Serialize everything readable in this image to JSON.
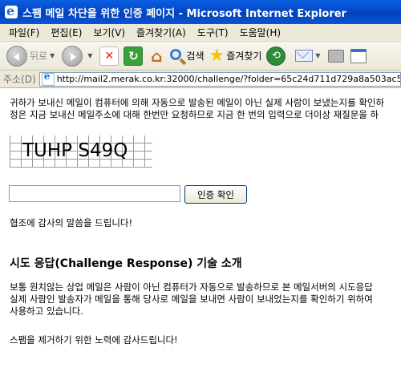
{
  "window": {
    "title": "스팸 메일 차단을 위한 인증 페이지 - Microsoft Internet Explorer"
  },
  "menu": {
    "items": [
      "파일(F)",
      "편집(E)",
      "보기(V)",
      "즐겨찾기(A)",
      "도구(T)",
      "도움말(H)"
    ]
  },
  "toolbar": {
    "back_label": "뒤로",
    "search_label": "검색",
    "favorites_label": "즐겨찾기"
  },
  "address": {
    "label": "주소(D)",
    "url": "http://mail2.merak.co.kr:32000/challenge/?folder=65c24d711d729a8a503ac5aa5c6"
  },
  "page": {
    "intro_line1": "귀하가 보내신 메일이 컴퓨터에 의해 자동으로 발송된 메일이 아닌 실제 사람이 보냈는지를 확인하",
    "intro_line2": "정은 지금 보내신 메일주소에 대해 한번만 요청하므로 지금 한 번의 입력으로 더이상 재질문을 하",
    "captcha_text": "TUHP S49Q",
    "answer_value": "",
    "confirm_button": "인증 확인",
    "thanks": "협조에 감사의 말씀을 드립니다!",
    "section_title": "시도 응답(Challenge Response) 기술 소개",
    "desc_line1": "보통 원치않는 상업 메일은 사람이 아닌 컴퓨터가 자동으로 발송하므로 본 메일서버의 시도응답",
    "desc_line2": "실제 사람인 발송자가 메일을 통해 당사로 메일을 보내면 사람이 보내었는지를 확인하기 위하여",
    "desc_line3": "사용하고 있습니다.",
    "footer_note": "스팸을 제거하기 위한 노력에 감사드립니다!"
  }
}
